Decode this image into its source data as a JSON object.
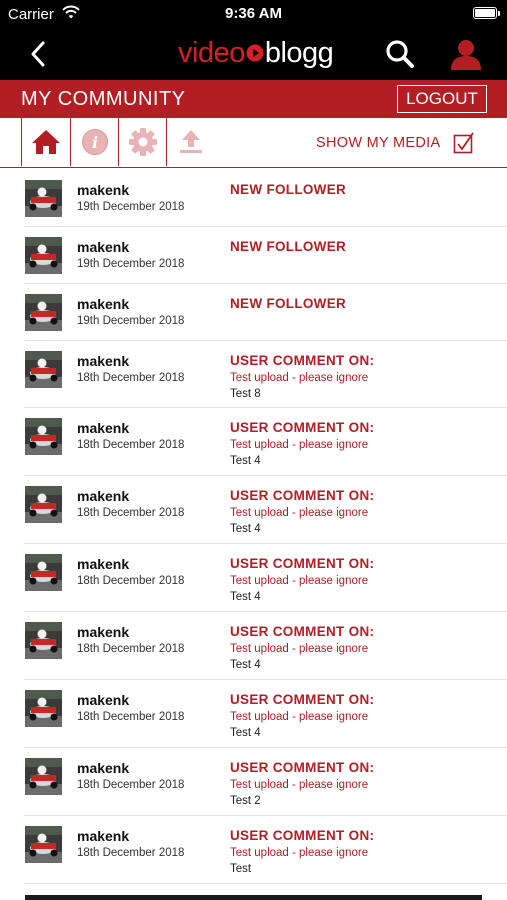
{
  "status_bar": {
    "carrier": "Carrier",
    "time": "9:36 AM",
    "battery_level": 1.0
  },
  "nav_bar": {
    "back_icon": "chevron-left-icon",
    "logo_part1": "video",
    "logo_part2": "blogg",
    "search_icon": "search-icon",
    "user_icon": "user-icon"
  },
  "community_bar": {
    "title": "MY COMMUNITY",
    "logout_label": "LOGOUT"
  },
  "toolbar": {
    "tools": [
      "home-icon",
      "info-icon",
      "gear-icon",
      "upload-icon"
    ],
    "show_media_label": "SHOW MY MEDIA",
    "show_media_checked": true
  },
  "colors": {
    "brand_red": "#b21e23",
    "logo_red": "#d41f28",
    "background": "#ffffff",
    "nav_black": "#000000"
  },
  "feed": {
    "items": [
      {
        "user": "makenk",
        "date": "19th December 2018",
        "action": "NEW FOLLOWER",
        "target": "",
        "comment": ""
      },
      {
        "user": "makenk",
        "date": "19th December 2018",
        "action": "NEW FOLLOWER",
        "target": "",
        "comment": ""
      },
      {
        "user": "makenk",
        "date": "19th December 2018",
        "action": "NEW FOLLOWER",
        "target": "",
        "comment": ""
      },
      {
        "user": "makenk",
        "date": "18th December 2018",
        "action": "USER COMMENT ON:",
        "target": "Test upload - please ignore",
        "comment": "Test 8"
      },
      {
        "user": "makenk",
        "date": "18th December 2018",
        "action": "USER COMMENT ON:",
        "target": "Test upload - please ignore",
        "comment": "Test 4"
      },
      {
        "user": "makenk",
        "date": "18th December 2018",
        "action": "USER COMMENT ON:",
        "target": "Test upload - please ignore",
        "comment": "Test 4"
      },
      {
        "user": "makenk",
        "date": "18th December 2018",
        "action": "USER COMMENT ON:",
        "target": "Test upload - please ignore",
        "comment": "Test 4"
      },
      {
        "user": "makenk",
        "date": "18th December 2018",
        "action": "USER COMMENT ON:",
        "target": "Test upload - please ignore",
        "comment": "Test 4"
      },
      {
        "user": "makenk",
        "date": "18th December 2018",
        "action": "USER COMMENT ON:",
        "target": "Test upload - please ignore",
        "comment": "Test 4"
      },
      {
        "user": "makenk",
        "date": "18th December 2018",
        "action": "USER COMMENT ON:",
        "target": "Test upload - please ignore",
        "comment": "Test 2"
      },
      {
        "user": "makenk",
        "date": "18th December 2018",
        "action": "USER COMMENT ON:",
        "target": "Test upload - please ignore",
        "comment": "Test"
      }
    ]
  }
}
